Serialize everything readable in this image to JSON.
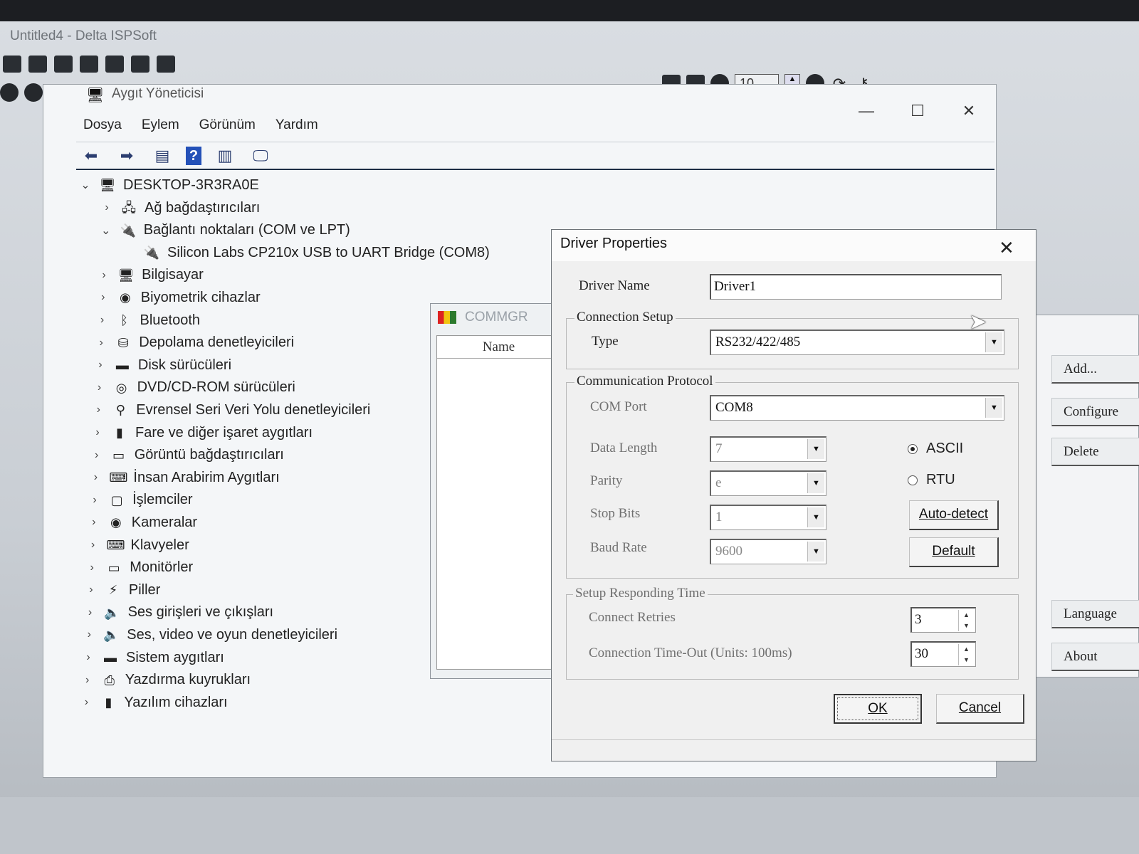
{
  "isp": {
    "title": "Untitled4 - Delta ISPSoft",
    "zoom_value": "10"
  },
  "device_manager": {
    "title": "Aygıt Yöneticisi",
    "menu": [
      "Dosya",
      "Eylem",
      "Görünüm",
      "Yardım"
    ],
    "window_controls": {
      "minimize": "—",
      "maximize": "☐",
      "close": "✕"
    },
    "root": "DESKTOP-3R3RA0E",
    "tree": [
      {
        "label": "Ağ bağdaştırıcıları",
        "expanded": false,
        "icon": "network-adapter-icon",
        "glyph": "🖧"
      },
      {
        "label": "Bağlantı noktaları (COM ve LPT)",
        "expanded": true,
        "icon": "port-icon",
        "glyph": "🔌"
      },
      {
        "label": "Silicon Labs CP210x USB to UART Bridge (COM8)",
        "child": true,
        "icon": "port-device-icon",
        "glyph": "🔌"
      },
      {
        "label": "Bilgisayar",
        "expanded": false,
        "icon": "computer-icon",
        "glyph": "🖥"
      },
      {
        "label": "Biyometrik cihazlar",
        "expanded": false,
        "icon": "biometric-icon",
        "glyph": "◉"
      },
      {
        "label": "Bluetooth",
        "expanded": false,
        "icon": "bluetooth-icon",
        "glyph": "ᛒ"
      },
      {
        "label": "Depolama denetleyicileri",
        "expanded": false,
        "icon": "storage-controller-icon",
        "glyph": "⛁"
      },
      {
        "label": "Disk sürücüleri",
        "expanded": false,
        "icon": "disk-drive-icon",
        "glyph": "▬"
      },
      {
        "label": "DVD/CD-ROM sürücüleri",
        "expanded": false,
        "icon": "dvd-icon",
        "glyph": "◎"
      },
      {
        "label": "Evrensel Seri Veri Yolu denetleyicileri",
        "expanded": false,
        "icon": "usb-icon",
        "glyph": "⚲"
      },
      {
        "label": "Fare ve diğer işaret aygıtları",
        "expanded": false,
        "icon": "mouse-icon",
        "glyph": "▮"
      },
      {
        "label": "Görüntü bağdaştırıcıları",
        "expanded": false,
        "icon": "display-adapter-icon",
        "glyph": "▭"
      },
      {
        "label": "İnsan Arabirim Aygıtları",
        "expanded": false,
        "icon": "hid-icon",
        "glyph": "⌨"
      },
      {
        "label": "İşlemciler",
        "expanded": false,
        "icon": "processor-icon",
        "glyph": "▢"
      },
      {
        "label": "Kameralar",
        "expanded": false,
        "icon": "camera-icon",
        "glyph": "◉"
      },
      {
        "label": "Klavyeler",
        "expanded": false,
        "icon": "keyboard-icon",
        "glyph": "⌨"
      },
      {
        "label": "Monitörler",
        "expanded": false,
        "icon": "monitor-icon",
        "glyph": "▭"
      },
      {
        "label": "Piller",
        "expanded": false,
        "icon": "battery-icon",
        "glyph": "⚡"
      },
      {
        "label": "Ses girişleri ve çıkışları",
        "expanded": false,
        "icon": "audio-icon",
        "glyph": "🔈"
      },
      {
        "label": "Ses, video ve oyun denetleyicileri",
        "expanded": false,
        "icon": "sound-controller-icon",
        "glyph": "🔈"
      },
      {
        "label": "Sistem aygıtları",
        "expanded": false,
        "icon": "system-devices-icon",
        "glyph": "▬"
      },
      {
        "label": "Yazdırma kuyrukları",
        "expanded": false,
        "icon": "print-queue-icon",
        "glyph": "⎙"
      },
      {
        "label": "Yazılım cihazları",
        "expanded": false,
        "icon": "software-device-icon",
        "glyph": "▮"
      }
    ]
  },
  "commgr": {
    "title": "COMMGR",
    "column_name": "Name"
  },
  "right_panel": {
    "buttons": [
      "Add...",
      "Configure",
      "Delete",
      "Language",
      "About"
    ]
  },
  "driver_properties": {
    "title": "Driver Properties",
    "close": "✕",
    "driver_name_label": "Driver Name",
    "driver_name_value": "Driver1",
    "connection_setup_legend": "Connection Setup",
    "type_label": "Type",
    "type_value": "RS232/422/485",
    "comm_protocol_legend": "Communication Protocol",
    "com_port_label": "COM Port",
    "com_port_value": "COM8",
    "data_length_label": "Data Length",
    "data_length_value": "7",
    "parity_label": "Parity",
    "parity_value": "e",
    "stop_bits_label": "Stop Bits",
    "stop_bits_value": "1",
    "baud_rate_label": "Baud Rate",
    "baud_rate_value": "9600",
    "mode_ascii": "ASCII",
    "mode_rtu": "RTU",
    "selected_mode": "ASCII",
    "auto_detect": "Auto-detect",
    "default": "Default",
    "responding_legend": "Setup Responding Time",
    "connect_retries_label": "Connect Retries",
    "connect_retries_value": "3",
    "timeout_label": "Connection Time-Out (Units: 100ms)",
    "timeout_value": "30",
    "ok": "OK",
    "cancel": "Cancel"
  }
}
